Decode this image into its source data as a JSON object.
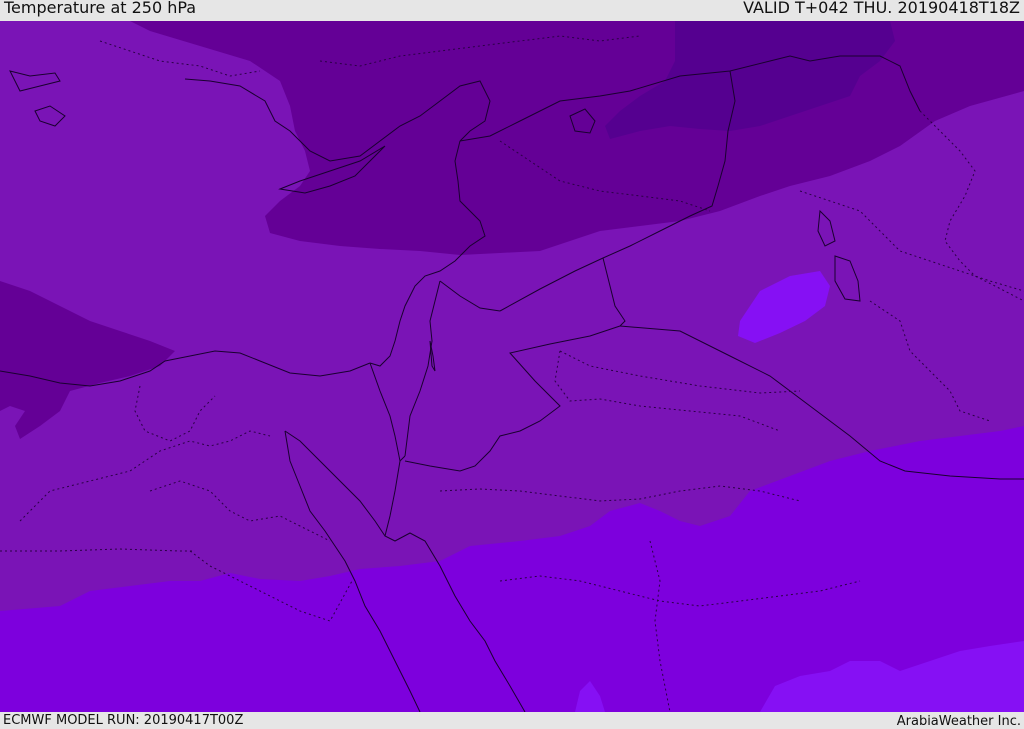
{
  "header": {
    "title": "Temperature at 250 hPa",
    "valid_time": "VALID T+042 THU. 20190418T18Z"
  },
  "footer": {
    "model_run": "ECMWF MODEL RUN: 20190417T00Z",
    "credit": "ArabiaWeather Inc."
  },
  "map": {
    "field": "Temperature",
    "level": "250 hPa",
    "region": "Eastern Mediterranean / Levant / Egypt / Arabian Peninsula",
    "shading_colors": {
      "darkest": "#550090",
      "dark": "#640096",
      "mid": "#7a14b6",
      "warm": "#7d00dd",
      "warmest": "#8610f4"
    },
    "coastline_color": "#1a0030",
    "border_style": "dotted"
  }
}
